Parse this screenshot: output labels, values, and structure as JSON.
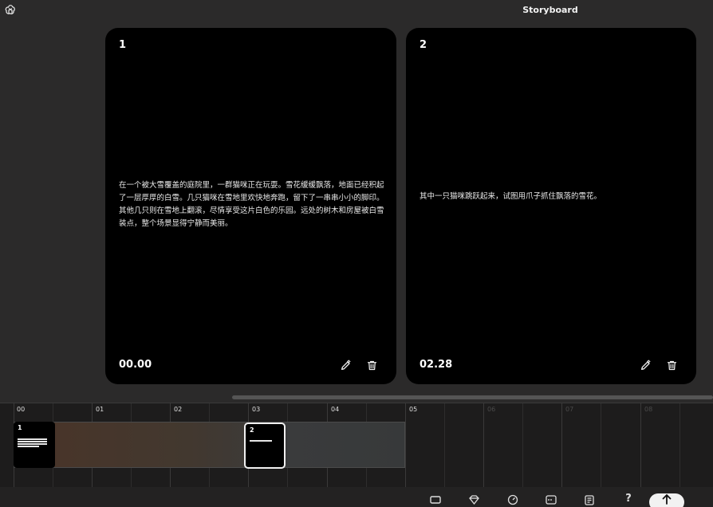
{
  "app": {
    "title": "Storyboard"
  },
  "cards": [
    {
      "number": "1",
      "text": "在一个被大雪覆盖的庭院里，一群猫咪正在玩耍。雪花缓缓飘落，地面已经积起了一层厚厚的白雪。几只猫咪在雪地里欢快地奔跑，留下了一串串小小的脚印。其他几只则在雪地上翻滚，尽情享受这片白色的乐园。远处的树木和房屋被白雪装点，整个场景显得宁静而美丽。",
      "time": "00.00"
    },
    {
      "number": "2",
      "text": "其中一只猫咪跳跃起来，试图用爪子抓住飘落的雪花。",
      "time": "02.28"
    }
  ],
  "timeline": {
    "ticks": [
      "00",
      "01",
      "02",
      "03",
      "04",
      "05",
      "06",
      "07",
      "08"
    ],
    "thumbnails": [
      {
        "number": "1"
      },
      {
        "number": "2"
      }
    ]
  },
  "toolbar": {
    "icons": [
      "aspect-ratio-icon",
      "style-icon",
      "speed-icon",
      "caption-icon",
      "script-icon",
      "help-icon",
      "upload-icon"
    ],
    "help_label": "?"
  },
  "colors": {
    "background": "#2b2a2a",
    "card": "#000000",
    "timeline": "#1d1c1c",
    "track_fill": "#4a3428",
    "accent": "#f2f2f2"
  }
}
